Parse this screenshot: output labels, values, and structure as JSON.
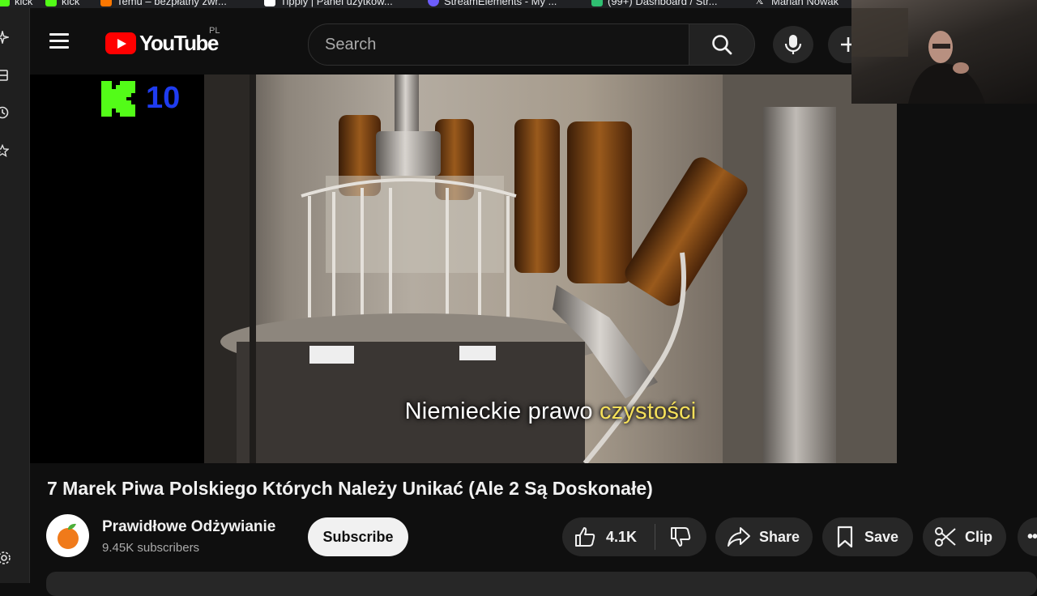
{
  "bookmarks": [
    {
      "label": "kick",
      "color": "#53fc18"
    },
    {
      "label": "kick",
      "color": "#53fc18"
    },
    {
      "label": "Temu – bezpłatny zwr...",
      "color": "#fb7701"
    },
    {
      "label": "Tipply | Panel użytkow...",
      "color": "#ffffff"
    },
    {
      "label": "StreamElements - My ...",
      "color": "#6d5dfc"
    },
    {
      "label": "(99+) Dashboard / Str...",
      "color": "#2fbf71"
    },
    {
      "label": "Marian Nowak",
      "color": "#ffffff"
    }
  ],
  "header": {
    "logo_text": "YouTube",
    "country_code": "PL",
    "search_placeholder": "Search",
    "icons": {
      "menu": "hamburger-icon",
      "search": "search-icon",
      "mic": "microphone-icon",
      "create": "plus-icon"
    }
  },
  "player": {
    "overlay_number": "10",
    "subtitle_plain": "Niemieckie prawo ",
    "subtitle_highlight": "czystości",
    "highlight_color": "#f5e05a"
  },
  "video": {
    "title": "7 Marek Piwa Polskiego Których Należy Unikać (Ale 2 Są Doskonałe)",
    "channel_name": "Prawidłowe Odżywianie",
    "subscribers": "9.45K subscribers",
    "subscribe_label": "Subscribe",
    "like_count": "4.1K",
    "share_label": "Share",
    "save_label": "Save",
    "clip_label": "Clip",
    "more_label": "•••"
  },
  "colors": {
    "accent": "#ff0000",
    "background": "#0f0f0f",
    "chip": "#272727"
  }
}
